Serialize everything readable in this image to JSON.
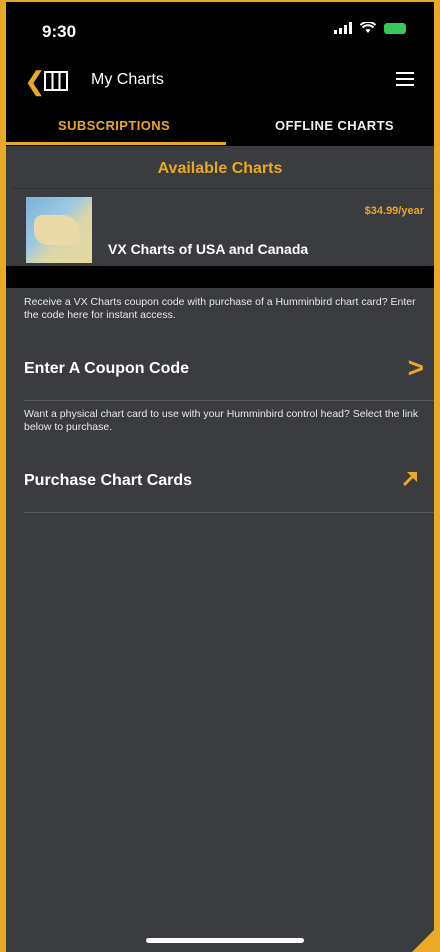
{
  "status_bar": {
    "time": "9:30"
  },
  "nav": {
    "title": "My Charts"
  },
  "tabs": [
    {
      "label": "SUBSCRIPTIONS"
    },
    {
      "label": "OFFLINE CHARTS"
    }
  ],
  "available": {
    "title": "Available Charts",
    "charts": [
      {
        "name": "VX Charts of USA and Canada",
        "price": "$34.99/year"
      }
    ]
  },
  "coupon": {
    "info": "Receive a VX Charts coupon code with purchase of a Humminbird chart card? Enter the code here for instant access.",
    "label": "Enter A Coupon Code"
  },
  "purchase": {
    "info": "Want a physical chart card to use with your Humminbird control head? Select the link below to purchase.",
    "label": "Purchase Chart Cards"
  },
  "colors": {
    "accent": "#e9a825",
    "background": "#3b3c3f",
    "bar": "#000000"
  }
}
